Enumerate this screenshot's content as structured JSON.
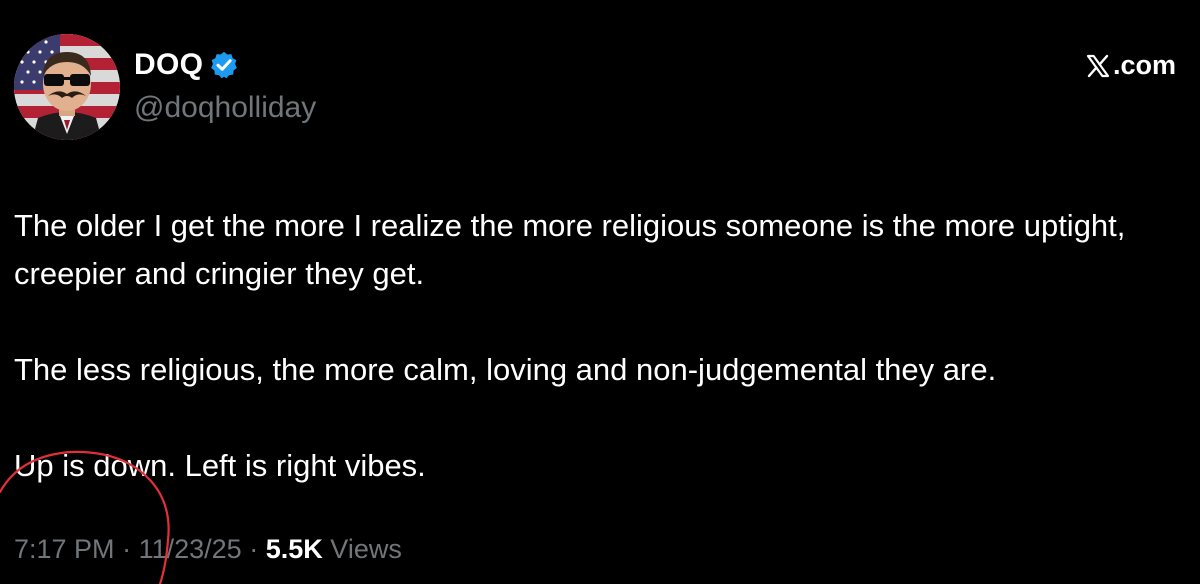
{
  "author": {
    "display_name": "DOQ",
    "handle": "@doqholliday",
    "verified_color": "#1d9bf0"
  },
  "source": {
    "label": ".com",
    "icon": "x-logo-icon"
  },
  "tweet": {
    "paragraphs": [
      "The older I get the more I realize the more religious someone is the more uptight, creepier and cringier they get.",
      "The less religious, the more calm, loving and non-judgemental they are.",
      "Up is down. Left is right vibes."
    ]
  },
  "meta": {
    "time": "7:17 PM",
    "separator": "·",
    "date": "11/23/25",
    "views_count": "5.5K",
    "views_label": "Views"
  },
  "colors": {
    "background": "#000000",
    "text": "#ffffff",
    "secondary": "#71767b",
    "annotation": "#e0303a"
  }
}
